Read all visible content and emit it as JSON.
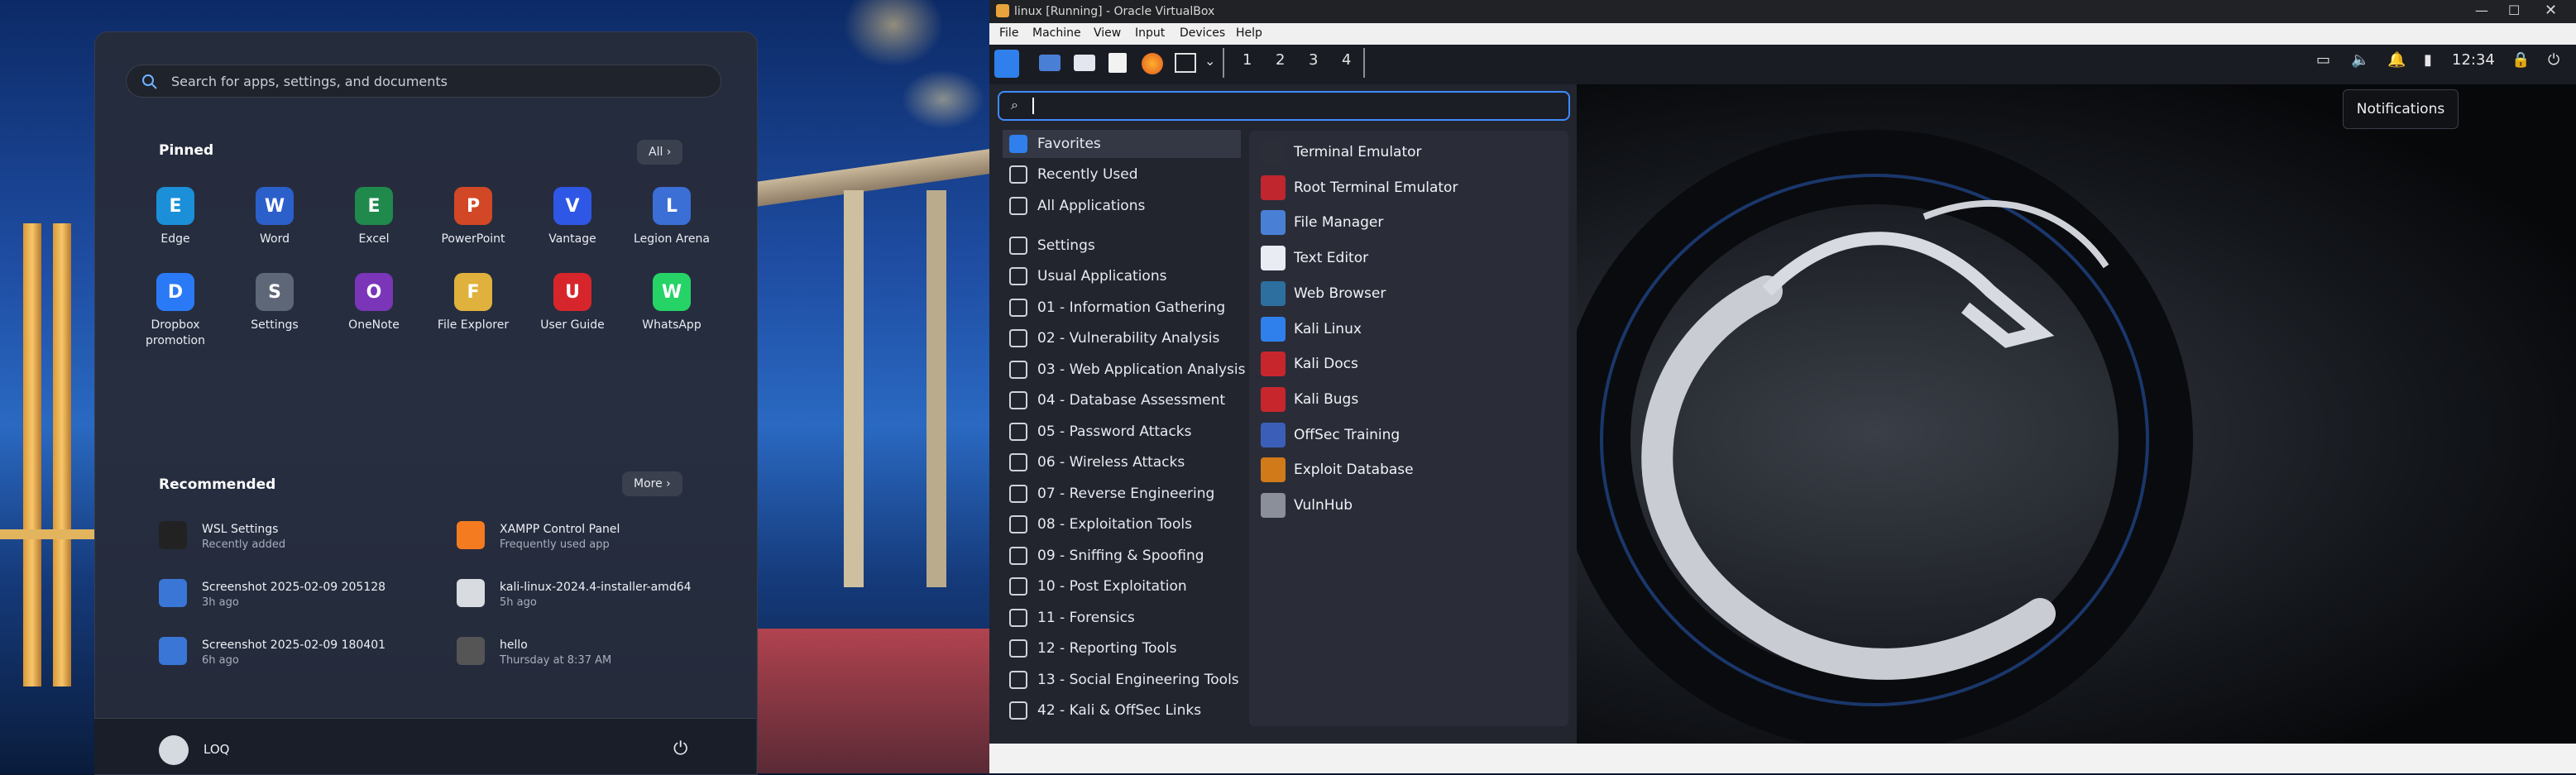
{
  "windows": {
    "start_menu": {
      "search_placeholder": "Search for apps, settings, and documents",
      "pinned_title": "Pinned",
      "all_label": "All",
      "pinned_apps": [
        {
          "label": "Edge",
          "icon": "edge-icon",
          "color": "#1b8fd8"
        },
        {
          "label": "Word",
          "icon": "word-icon",
          "color": "#2b5fc9"
        },
        {
          "label": "Excel",
          "icon": "excel-icon",
          "color": "#1f8a4c"
        },
        {
          "label": "PowerPoint",
          "icon": "powerpoint-icon",
          "color": "#d24726"
        },
        {
          "label": "Vantage",
          "icon": "vantage-icon",
          "color": "#2f57e6"
        },
        {
          "label": "Legion Arena",
          "icon": "legion-arena-icon",
          "color": "#3b6fd6"
        },
        {
          "label": "Dropbox promotion",
          "icon": "dropbox-icon",
          "color": "#2a7af7"
        },
        {
          "label": "Settings",
          "icon": "settings-icon",
          "color": "#5e6778"
        },
        {
          "label": "OneNote",
          "icon": "onenote-icon",
          "color": "#7a35b8"
        },
        {
          "label": "File Explorer",
          "icon": "file-explorer-icon",
          "color": "#e0b13c"
        },
        {
          "label": "User Guide",
          "icon": "user-guide-icon",
          "color": "#d7262b"
        },
        {
          "label": "WhatsApp",
          "icon": "whatsapp-icon",
          "color": "#25d366"
        }
      ],
      "recommended_title": "Recommended",
      "more_label": "More",
      "recommended": [
        {
          "title": "WSL Settings",
          "subtitle": "Recently added",
          "icon": "penguin-icon"
        },
        {
          "title": "XAMPP Control Panel",
          "subtitle": "Frequently used app",
          "icon": "xampp-icon"
        },
        {
          "title": "Screenshot 2025-02-09 205128",
          "subtitle": "3h ago",
          "icon": "image-file-icon"
        },
        {
          "title": "kali-linux-2024.4-installer-amd64",
          "subtitle": "5h ago",
          "icon": "disc-image-icon"
        },
        {
          "title": "Screenshot 2025-02-09 180401",
          "subtitle": "6h ago",
          "icon": "image-file-icon"
        },
        {
          "title": "hello",
          "subtitle": "Thursday at 8:37 AM",
          "icon": "text-file-icon"
        }
      ],
      "user_name": "LOQ"
    }
  },
  "vbox": {
    "title": "linux [Running] - Oracle VirtualBox",
    "menus": [
      "File",
      "Machine",
      "View",
      "Input",
      "Devices",
      "Help"
    ]
  },
  "kali": {
    "workspaces": [
      "1",
      "2",
      "3",
      "4"
    ],
    "clock": "12:34",
    "tooltip": "Notifications",
    "categories": [
      "Favorites",
      "Recently Used",
      "All Applications",
      "Settings",
      "Usual Applications",
      "01 - Information Gathering",
      "02 - Vulnerability Analysis",
      "03 - Web Application Analysis",
      "04 - Database Assessment",
      "05 - Password Attacks",
      "06 - Wireless Attacks",
      "07 - Reverse Engineering",
      "08 - Exploitation Tools",
      "09 - Sniffing & Spoofing",
      "10 - Post Exploitation",
      "11 - Forensics",
      "12 - Reporting Tools",
      "13 - Social Engineering Tools",
      "42 - Kali & OffSec Links"
    ],
    "favorites": [
      {
        "label": "Terminal Emulator",
        "icon": "terminal-icon",
        "color": "#2b2e36"
      },
      {
        "label": "Root Terminal Emulator",
        "icon": "root-terminal-icon",
        "color": "#c0262d"
      },
      {
        "label": "File Manager",
        "icon": "folder-icon",
        "color": "#4a7fd6"
      },
      {
        "label": "Text Editor",
        "icon": "text-editor-icon",
        "color": "#e9ecf2"
      },
      {
        "label": "Web Browser",
        "icon": "globe-icon",
        "color": "#2d6f9e"
      },
      {
        "label": "Kali Linux",
        "icon": "kali-linux-icon",
        "color": "#2f80ed"
      },
      {
        "label": "Kali Docs",
        "icon": "kali-docs-icon",
        "color": "#c7262d"
      },
      {
        "label": "Kali Bugs",
        "icon": "kali-bugs-icon",
        "color": "#c7262d"
      },
      {
        "label": "OffSec Training",
        "icon": "offsec-icon",
        "color": "#3b5fb8"
      },
      {
        "label": "Exploit Database",
        "icon": "exploit-db-icon",
        "color": "#d07a1a"
      },
      {
        "label": "VulnHub",
        "icon": "vulnhub-icon",
        "color": "#8a8f99"
      }
    ]
  }
}
